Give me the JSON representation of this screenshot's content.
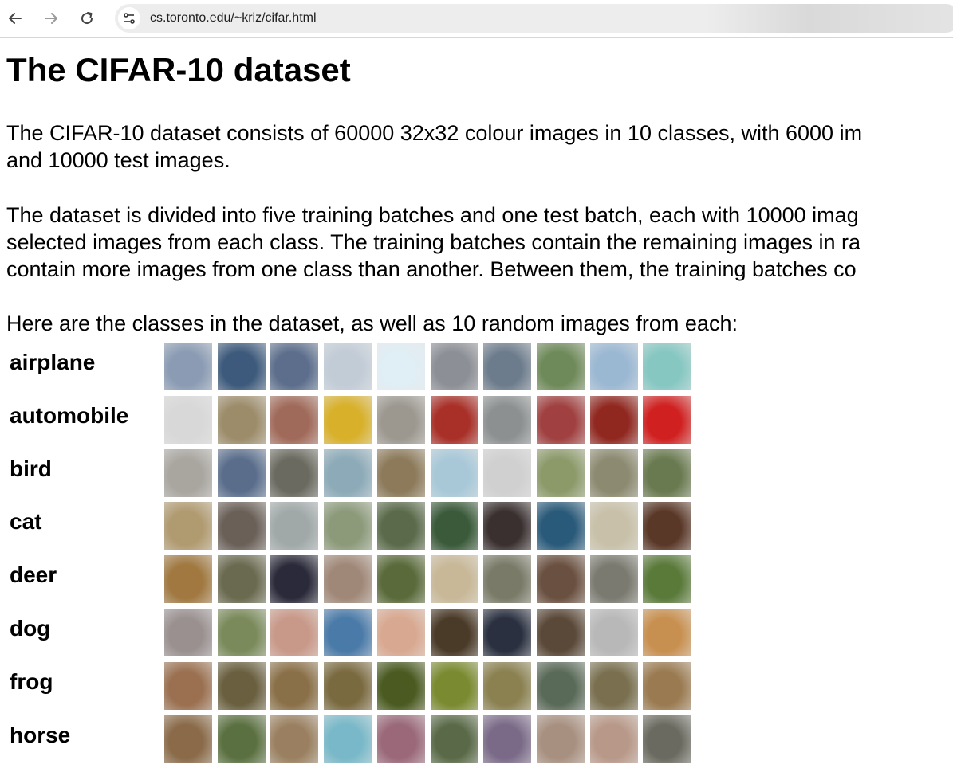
{
  "browser": {
    "url": "cs.toronto.edu/~kriz/cifar.html",
    "icons": [
      "back-arrow-icon",
      "forward-arrow-icon",
      "reload-icon",
      "site-info-icon"
    ]
  },
  "page": {
    "title": "The CIFAR-10 dataset",
    "paragraphs": [
      "The CIFAR-10 dataset consists of 60000 32x32 colour images in 10 classes, with 6000 im\nand 10000 test images.",
      "The dataset is divided into five training batches and one test batch, each with 10000 imag\nselected images from each class. The training batches contain the remaining images in ra\ncontain more images from one class than another. Between them, the training batches co",
      "Here are the classes in the dataset, as well as 10 random images from each:"
    ],
    "classes": [
      {
        "label": "airplane",
        "colors": [
          "#8a9bb3",
          "#3d5a7c",
          "#5c6e8c",
          "#c2ccd7",
          "#e0eef5",
          "#8c8f96",
          "#6d7c8c",
          "#6f8a5a",
          "#9bb8d3",
          "#86c7c2"
        ]
      },
      {
        "label": "automobile",
        "colors": [
          "#d8d8d8",
          "#9c8c6a",
          "#a06a5a",
          "#d8b02a",
          "#9c9890",
          "#a83028",
          "#8c9090",
          "#a04040",
          "#902820",
          "#d02020"
        ]
      },
      {
        "label": "bird",
        "colors": [
          "#a9a6a0",
          "#5a6e8c",
          "#6a6a60",
          "#8caab8",
          "#8c7a5a",
          "#a8c8d8",
          "#d0d0d0",
          "#8c9a6a",
          "#8c8a70",
          "#6a7a50"
        ]
      },
      {
        "label": "cat",
        "colors": [
          "#b09a70",
          "#6a6058",
          "#a0a8a8",
          "#8c9a7a",
          "#5a6a4a",
          "#3a5a3a",
          "#3a3030",
          "#2a5a7a",
          "#c8c0a8",
          "#5a3828"
        ]
      },
      {
        "label": "deer",
        "colors": [
          "#a07840",
          "#6a6a50",
          "#2a2a3a",
          "#a08878",
          "#5a6a3a",
          "#c8b898",
          "#7a7a68",
          "#6a5040",
          "#7a7a70",
          "#5a7a3a"
        ]
      },
      {
        "label": "dog",
        "colors": [
          "#9a9090",
          "#7a8a5a",
          "#c89888",
          "#4a7aa8",
          "#d8a890",
          "#4a3a28",
          "#2a3040",
          "#5a4838",
          "#b8b8b8",
          "#c89050"
        ]
      },
      {
        "label": "frog",
        "colors": [
          "#9a7050",
          "#6a6040",
          "#8a7048",
          "#7a6a40",
          "#4a5a20",
          "#7a8a30",
          "#8a8050",
          "#5a6a58",
          "#7a7050",
          "#9a7a50"
        ]
      },
      {
        "label": "horse",
        "colors": [
          "#8a6a48",
          "#5a7040",
          "#9a8060",
          "#78b8c8",
          "#9a6878",
          "#5a6a48",
          "#7a6a88",
          "#a89080",
          "#b89888",
          "#6a6a60"
        ]
      }
    ]
  }
}
